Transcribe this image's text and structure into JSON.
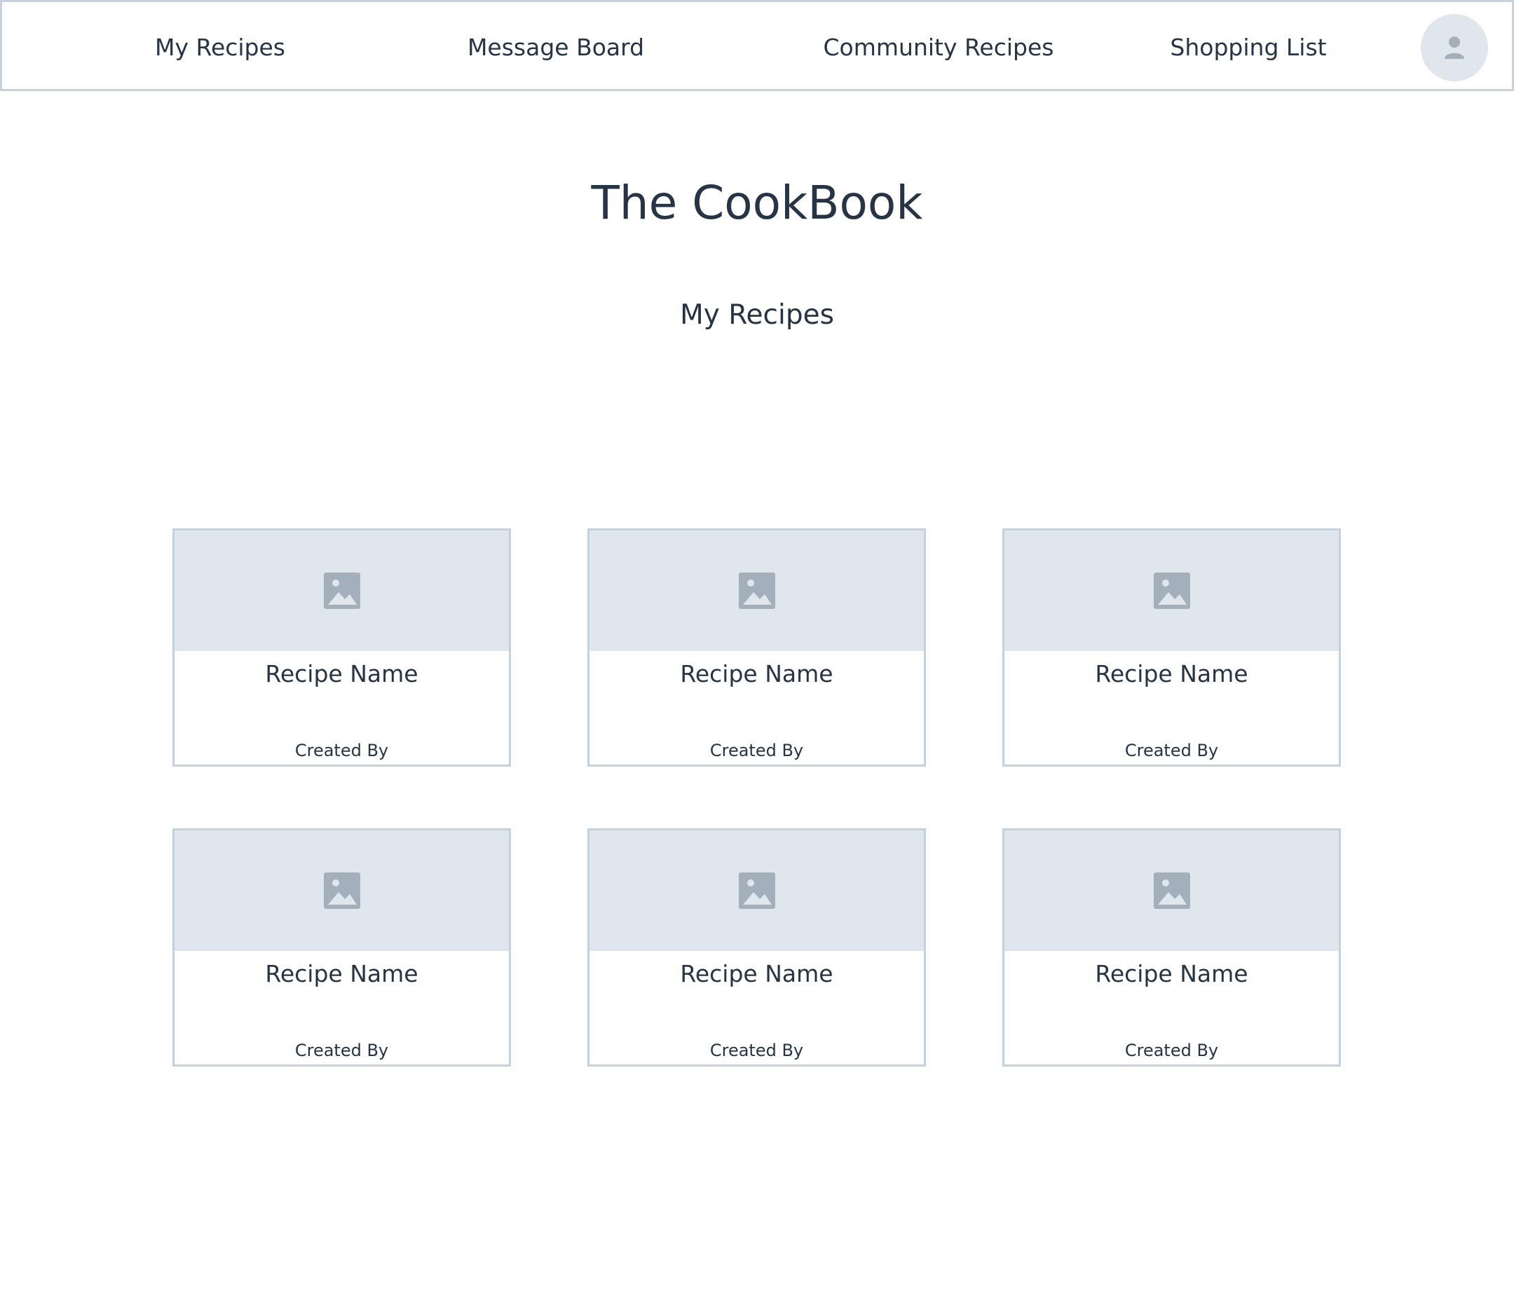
{
  "nav": {
    "items": [
      {
        "label": "My Recipes"
      },
      {
        "label": "Message Board"
      },
      {
        "label": "Community Recipes"
      },
      {
        "label": "Shopping List"
      }
    ],
    "avatar_icon": "user-icon"
  },
  "header": {
    "title": "The CookBook",
    "section": "My Recipes"
  },
  "recipes": [
    {
      "name": "Recipe Name",
      "created_by": "Created By",
      "image_icon": "image-placeholder-icon"
    },
    {
      "name": "Recipe Name",
      "created_by": "Created By",
      "image_icon": "image-placeholder-icon"
    },
    {
      "name": "Recipe Name",
      "created_by": "Created By",
      "image_icon": "image-placeholder-icon"
    },
    {
      "name": "Recipe Name",
      "created_by": "Created By",
      "image_icon": "image-placeholder-icon"
    },
    {
      "name": "Recipe Name",
      "created_by": "Created By",
      "image_icon": "image-placeholder-icon"
    },
    {
      "name": "Recipe Name",
      "created_by": "Created By",
      "image_icon": "image-placeholder-icon"
    }
  ],
  "colors": {
    "text": "#263445",
    "border": "#c6d1dc",
    "placeholder_bg": "#e0e6ee",
    "icon": "#a3b0bc"
  }
}
